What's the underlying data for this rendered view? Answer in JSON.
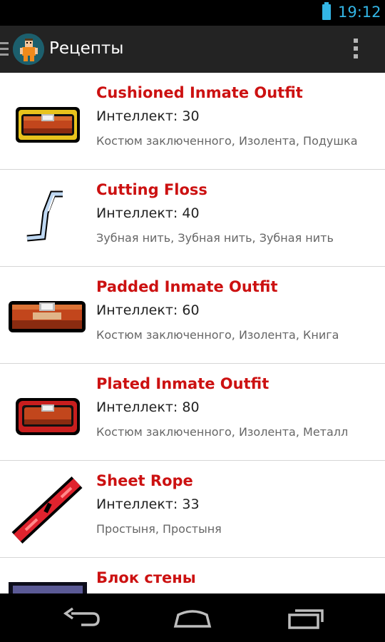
{
  "status": {
    "time": "19:12"
  },
  "app": {
    "title": "Рецепты"
  },
  "recipes": [
    {
      "name": "Cushioned Inmate Outfit",
      "intellect": "Интеллект: 30",
      "ingredients": "Костюм заключенного, Изолента, Подушка"
    },
    {
      "name": "Cutting Floss",
      "intellect": "Интеллект: 40",
      "ingredients": "Зубная нить, Зубная нить, Зубная нить"
    },
    {
      "name": "Padded Inmate Outfit",
      "intellect": "Интеллект: 60",
      "ingredients": "Костюм заключенного, Изолента, Книга"
    },
    {
      "name": "Plated Inmate Outfit",
      "intellect": "Интеллект: 80",
      "ingredients": "Костюм заключенного, Изолента, Металл"
    },
    {
      "name": "Sheet Rope",
      "intellect": "Интеллект: 33",
      "ingredients": "Простыня, Простыня"
    },
    {
      "name": "Блок стены"
    }
  ],
  "icons": {
    "drawer": "menu-drawer-icon",
    "overflow": "overflow-menu-icon",
    "battery": "battery-icon",
    "back": "back-icon",
    "home": "home-icon",
    "recents": "recent-apps-icon"
  },
  "colors": {
    "accent_status": "#33b5e5",
    "item_title": "#cc1111",
    "action_bar": "#232323"
  }
}
